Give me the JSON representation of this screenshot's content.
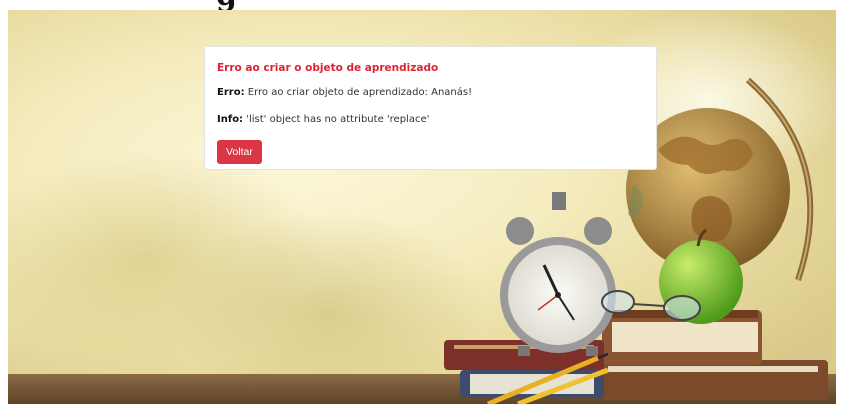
{
  "page": {
    "heading_partial": "g"
  },
  "alert": {
    "title": "Erro ao criar o objeto de aprendizado",
    "error_label": "Erro:",
    "error_text": "Erro ao criar objeto de aprendizado: Ananás!",
    "info_label": "Info:",
    "info_text": "'list' object has no attribute 'replace'",
    "back_button_label": "Voltar"
  },
  "colors": {
    "accent_red": "#dc3545",
    "title_red": "#dc2333",
    "card_bg": "#ffffff"
  },
  "background": {
    "icons": [
      "globe-icon",
      "alarm-clock-icon",
      "apple-icon",
      "books-icon",
      "pencils-icon",
      "glasses-icon"
    ]
  }
}
